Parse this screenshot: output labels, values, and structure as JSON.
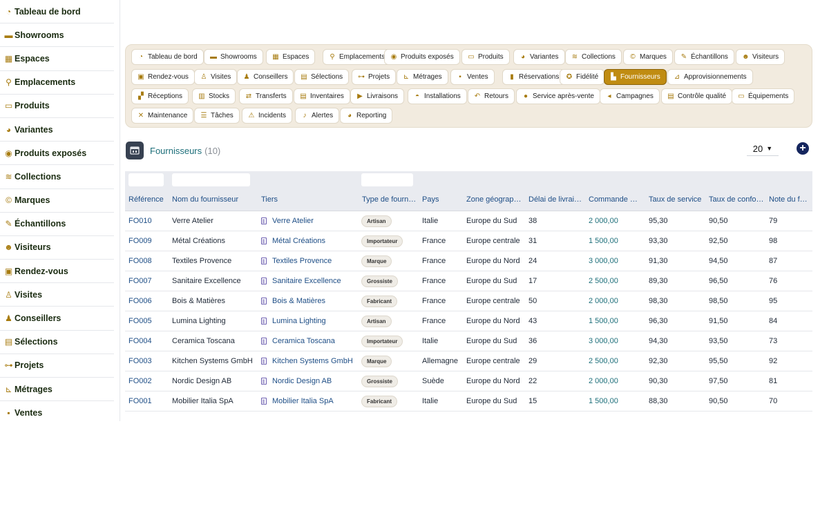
{
  "sidebar": {
    "items": [
      {
        "label": "Tableau de bord",
        "icon": "gauge-icon",
        "glyph": "◔"
      },
      {
        "label": "Showrooms",
        "icon": "sofa-icon",
        "glyph": "▬"
      },
      {
        "label": "Espaces",
        "icon": "grid-icon",
        "glyph": "▦"
      },
      {
        "label": "Emplacements",
        "icon": "map-pin-icon",
        "glyph": "⚲"
      },
      {
        "label": "Produits",
        "icon": "couch-icon",
        "glyph": "▭"
      },
      {
        "label": "Variantes",
        "icon": "palette-icon",
        "glyph": "◕"
      },
      {
        "label": "Produits exposés",
        "icon": "eye-icon",
        "glyph": "◉"
      },
      {
        "label": "Collections",
        "icon": "layers-icon",
        "glyph": "≋"
      },
      {
        "label": "Marques",
        "icon": "copyright-icon",
        "glyph": "©"
      },
      {
        "label": "Échantillons",
        "icon": "eyedropper-icon",
        "glyph": "✎"
      },
      {
        "label": "Visiteurs",
        "icon": "users-icon",
        "glyph": "☻"
      },
      {
        "label": "Rendez-vous",
        "icon": "calendar-check-icon",
        "glyph": "▣"
      },
      {
        "label": "Visites",
        "icon": "walking-icon",
        "glyph": "♙"
      },
      {
        "label": "Conseillers",
        "icon": "user-tie-icon",
        "glyph": "♟"
      },
      {
        "label": "Sélections",
        "icon": "clipboard-icon",
        "glyph": "▤"
      },
      {
        "label": "Projets",
        "icon": "project-diagram-icon",
        "glyph": "⊶"
      },
      {
        "label": "Métrages",
        "icon": "ruler-icon",
        "glyph": "⊾"
      },
      {
        "label": "Ventes",
        "icon": "cart-icon",
        "glyph": "▪"
      }
    ]
  },
  "tabs": [
    {
      "label": "Tableau de bord",
      "icon": "gauge-icon",
      "glyph": "◔"
    },
    {
      "label": "Showrooms",
      "icon": "sofa-icon",
      "glyph": "▬"
    },
    {
      "label": "Espaces",
      "icon": "grid-icon",
      "glyph": "▦"
    },
    {
      "label": "Emplacements",
      "icon": "map-pin-icon",
      "glyph": "⚲"
    },
    {
      "label": "Produits exposés",
      "icon": "eye-icon",
      "glyph": "◉"
    },
    {
      "label": "Produits",
      "icon": "couch-icon",
      "glyph": "▭"
    },
    {
      "label": "Variantes",
      "icon": "palette-icon",
      "glyph": "◕"
    },
    {
      "label": "Collections",
      "icon": "layers-icon",
      "glyph": "≋"
    },
    {
      "label": "Marques",
      "icon": "copyright-icon",
      "glyph": "©"
    },
    {
      "label": "Échantillons",
      "icon": "eyedropper-icon",
      "glyph": "✎"
    },
    {
      "label": "Visiteurs",
      "icon": "users-icon",
      "glyph": "☻"
    },
    {
      "label": "Rendez-vous",
      "icon": "calendar-check-icon",
      "glyph": "▣"
    },
    {
      "label": "Visites",
      "icon": "walking-icon",
      "glyph": "♙"
    },
    {
      "label": "Conseillers",
      "icon": "user-tie-icon",
      "glyph": "♟"
    },
    {
      "label": "Sélections",
      "icon": "clipboard-icon",
      "glyph": "▤"
    },
    {
      "label": "Projets",
      "icon": "project-diagram-icon",
      "glyph": "⊶"
    },
    {
      "label": "Métrages",
      "icon": "ruler-icon",
      "glyph": "⊾"
    },
    {
      "label": "Ventes",
      "icon": "cart-icon",
      "glyph": "▪"
    },
    {
      "label": "Réservations",
      "icon": "bookmark-icon",
      "glyph": "▮"
    },
    {
      "label": "Fidélité",
      "icon": "award-icon",
      "glyph": "✪"
    },
    {
      "label": "Fournisseurs",
      "icon": "industry-icon",
      "glyph": "▙",
      "active": true
    },
    {
      "label": "Approvisionnements",
      "icon": "dolly-icon",
      "glyph": "⊿"
    },
    {
      "label": "Réceptions",
      "icon": "truck-loading-icon",
      "glyph": "▞"
    },
    {
      "label": "Stocks",
      "icon": "warehouse-icon",
      "glyph": "▥"
    },
    {
      "label": "Transferts",
      "icon": "exchange-icon",
      "glyph": "⇄"
    },
    {
      "label": "Inventaires",
      "icon": "clipboard-check-icon",
      "glyph": "▤"
    },
    {
      "label": "Livraisons",
      "icon": "shipping-fast-icon",
      "glyph": "▶"
    },
    {
      "label": "Installations",
      "icon": "hard-hat-icon",
      "glyph": "◓"
    },
    {
      "label": "Retours",
      "icon": "undo-icon",
      "glyph": "↶"
    },
    {
      "label": "Service après-vente",
      "icon": "comment-icon",
      "glyph": "●"
    },
    {
      "label": "Campagnes",
      "icon": "bullhorn-icon",
      "glyph": "◂"
    },
    {
      "label": "Contrôle qualité",
      "icon": "clipboard-list-icon",
      "glyph": "▤"
    },
    {
      "label": "Équipements",
      "icon": "desktop-icon",
      "glyph": "▭"
    },
    {
      "label": "Maintenance",
      "icon": "tools-icon",
      "glyph": "✕"
    },
    {
      "label": "Tâches",
      "icon": "tasks-icon",
      "glyph": "☰"
    },
    {
      "label": "Incidents",
      "icon": "warning-icon",
      "glyph": "⚠"
    },
    {
      "label": "Alertes",
      "icon": "bell-icon",
      "glyph": "♪"
    },
    {
      "label": "Reporting",
      "icon": "chart-pie-icon",
      "glyph": "◕"
    }
  ],
  "header": {
    "title": "Fournisseurs",
    "count": "(10)",
    "page_size": "20",
    "add_label": "+"
  },
  "table": {
    "columns": [
      "Référence",
      "Nom du fournisseur",
      "Tiers",
      "Type de fournisseur",
      "Pays",
      "Zone géographique",
      "Délai de livraison",
      "Commande minimum",
      "Taux de service",
      "Taux de conformité",
      "Note du fournisseur"
    ],
    "rows": [
      {
        "ref": "FO010",
        "nom": "Verre Atelier",
        "tiers": "Verre Atelier",
        "type": "Artisan",
        "pays": "Italie",
        "zone": "Europe du Sud",
        "delai": "38",
        "commande": "2 000,00",
        "service": "95,30",
        "conformite": "90,50",
        "note": "79"
      },
      {
        "ref": "FO009",
        "nom": "Métal Créations",
        "tiers": "Métal Créations",
        "type": "Importateur",
        "pays": "France",
        "zone": "Europe centrale",
        "delai": "31",
        "commande": "1 500,00",
        "service": "93,30",
        "conformite": "92,50",
        "note": "98"
      },
      {
        "ref": "FO008",
        "nom": "Textiles Provence",
        "tiers": "Textiles Provence",
        "type": "Marque",
        "pays": "France",
        "zone": "Europe du Nord",
        "delai": "24",
        "commande": "3 000,00",
        "service": "91,30",
        "conformite": "94,50",
        "note": "87"
      },
      {
        "ref": "FO007",
        "nom": "Sanitaire Excellence",
        "tiers": "Sanitaire Excellence",
        "type": "Grossiste",
        "pays": "France",
        "zone": "Europe du Sud",
        "delai": "17",
        "commande": "2 500,00",
        "service": "89,30",
        "conformite": "96,50",
        "note": "76"
      },
      {
        "ref": "FO006",
        "nom": "Bois & Matières",
        "tiers": "Bois & Matières",
        "type": "Fabricant",
        "pays": "France",
        "zone": "Europe centrale",
        "delai": "50",
        "commande": "2 000,00",
        "service": "98,30",
        "conformite": "98,50",
        "note": "95"
      },
      {
        "ref": "FO005",
        "nom": "Lumina Lighting",
        "tiers": "Lumina Lighting",
        "type": "Artisan",
        "pays": "France",
        "zone": "Europe du Nord",
        "delai": "43",
        "commande": "1 500,00",
        "service": "96,30",
        "conformite": "91,50",
        "note": "84"
      },
      {
        "ref": "FO004",
        "nom": "Ceramica Toscana",
        "tiers": "Ceramica Toscana",
        "type": "Importateur",
        "pays": "Italie",
        "zone": "Europe du Sud",
        "delai": "36",
        "commande": "3 000,00",
        "service": "94,30",
        "conformite": "93,50",
        "note": "73"
      },
      {
        "ref": "FO003",
        "nom": "Kitchen Systems GmbH",
        "tiers": "Kitchen Systems GmbH",
        "type": "Marque",
        "pays": "Allemagne",
        "zone": "Europe centrale",
        "delai": "29",
        "commande": "2 500,00",
        "service": "92,30",
        "conformite": "95,50",
        "note": "92"
      },
      {
        "ref": "FO002",
        "nom": "Nordic Design AB",
        "tiers": "Nordic Design AB",
        "type": "Grossiste",
        "pays": "Suède",
        "zone": "Europe du Nord",
        "delai": "22",
        "commande": "2 000,00",
        "service": "90,30",
        "conformite": "97,50",
        "note": "81"
      },
      {
        "ref": "FO001",
        "nom": "Mobilier Italia SpA",
        "tiers": "Mobilier Italia SpA",
        "type": "Fabricant",
        "pays": "Italie",
        "zone": "Europe du Sud",
        "delai": "15",
        "commande": "1 500,00",
        "service": "88,30",
        "conformite": "90,50",
        "note": "70"
      }
    ]
  },
  "colors": {
    "accent": "#c08c12",
    "icon": "#a77b0f",
    "link": "#1e4e86",
    "money": "#1d6f7a",
    "add_button": "#15265e"
  }
}
